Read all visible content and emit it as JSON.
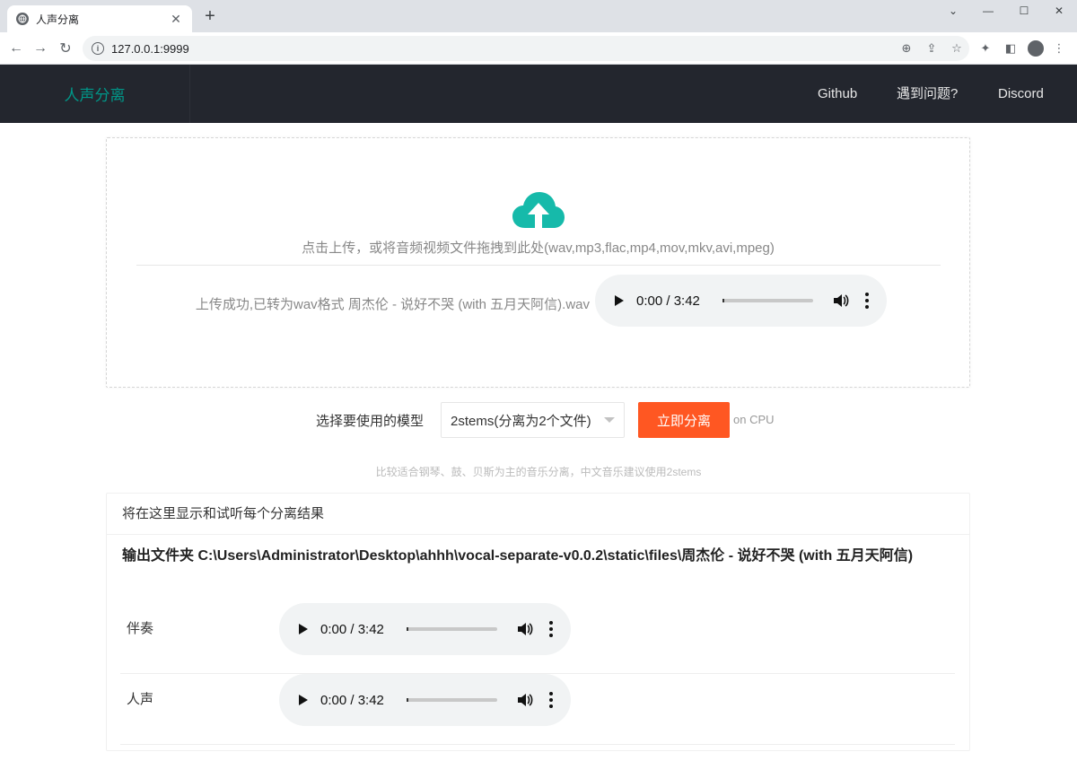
{
  "browser": {
    "tab_title": "人声分离",
    "url": "127.0.0.1:9999"
  },
  "app": {
    "brand": "人声分离",
    "nav": [
      "Github",
      "遇到问题?",
      "Discord"
    ]
  },
  "upload": {
    "hint": "点击上传，或将音频视频文件拖拽到此处(wav,mp3,flac,mp4,mov,mkv,avi,mpeg)",
    "status": "上传成功,已转为wav格式 周杰伦 - 说好不哭 (with 五月天阿信).wav",
    "player_time": "0:00 / 3:42"
  },
  "model": {
    "label": "选择要使用的模型",
    "selected": "2stems(分离为2个文件)",
    "button": "立即分离",
    "device": "on CPU",
    "tip": "比较适合钢琴、鼓、贝斯为主的音乐分离，中文音乐建议使用2stems"
  },
  "results": {
    "header": "将在这里显示和试听每个分离结果",
    "folder": "输出文件夹 C:\\Users\\Administrator\\Desktop\\ahhh\\vocal-separate-v0.0.2\\static\\files\\周杰伦 - 说好不哭 (with 五月天阿信)",
    "items": [
      {
        "label": "伴奏",
        "time": "0:00 / 3:42"
      },
      {
        "label": "人声",
        "time": "0:00 / 3:42"
      }
    ]
  },
  "colors": {
    "accent": "#009688",
    "button": "#ff5722",
    "navbar": "#23262e"
  }
}
